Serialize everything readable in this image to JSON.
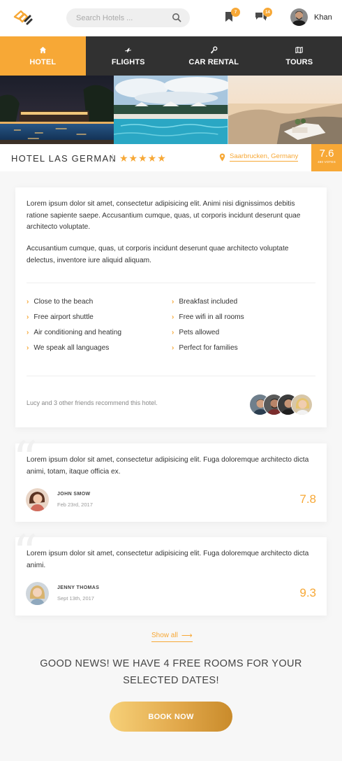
{
  "header": {
    "search_placeholder": "Search Hotels ...",
    "bookmark_count": "7",
    "message_count": "14",
    "user_name": "Khan"
  },
  "tabs": [
    {
      "label": "HOTEL",
      "icon": "home-icon",
      "active": true
    },
    {
      "label": "FLIGHTS",
      "icon": "plane-icon",
      "active": false
    },
    {
      "label": "CAR RENTAL",
      "icon": "key-icon",
      "active": false
    },
    {
      "label": "TOURS",
      "icon": "map-icon",
      "active": false
    }
  ],
  "hotel": {
    "name": "HOTEL LAS GERMAN",
    "stars": "★★★★★",
    "location": "Saarbrucken, Germany",
    "score": "7.6",
    "score_label": "480 VOTES"
  },
  "description": {
    "paragraph_1": "Lorem ipsum dolor sit amet, consectetur adipisicing elit. Animi nisi dignissimos debitis ratione sapiente saepe. Accusantium cumque, quas, ut corporis incidunt deserunt quae architecto voluptate.",
    "paragraph_2": "Accusantium cumque, quas, ut corporis incidunt deserunt quae architecto voluptate delectus, inventore iure aliquid aliquam.",
    "features_left": [
      "Close to the beach",
      "Free airport shuttle",
      "Air conditioning and heating",
      "We speak all languages"
    ],
    "features_right": [
      "Breakfast included",
      "Free wifi in all rooms",
      "Pets allowed",
      "Perfect for families"
    ],
    "recommend_text": "Lucy and 3 other friends recommend this hotel."
  },
  "reviews": [
    {
      "text": "Lorem ipsum dolor sit amet, consectetur adipisicing elit. Fuga doloremque architecto dicta animi, totam, itaque officia ex.",
      "name": "JOHN SMOW",
      "date": "Feb 23rd, 2017",
      "score": "7.8"
    },
    {
      "text": "Lorem ipsum dolor sit amet, consectetur adipisicing elit. Fuga doloremque architecto dicta animi.",
      "name": "JENNY THOMAS",
      "date": "Sept 13th, 2017",
      "score": "9.3"
    }
  ],
  "show_all": "Show all",
  "good_news": "GOOD NEWS! WE HAVE 4 FREE ROOMS FOR YOUR SELECTED DATES!",
  "book_button": "BOOK NOW",
  "colors": {
    "accent": "#f7a836",
    "nav_dark": "#313131"
  }
}
